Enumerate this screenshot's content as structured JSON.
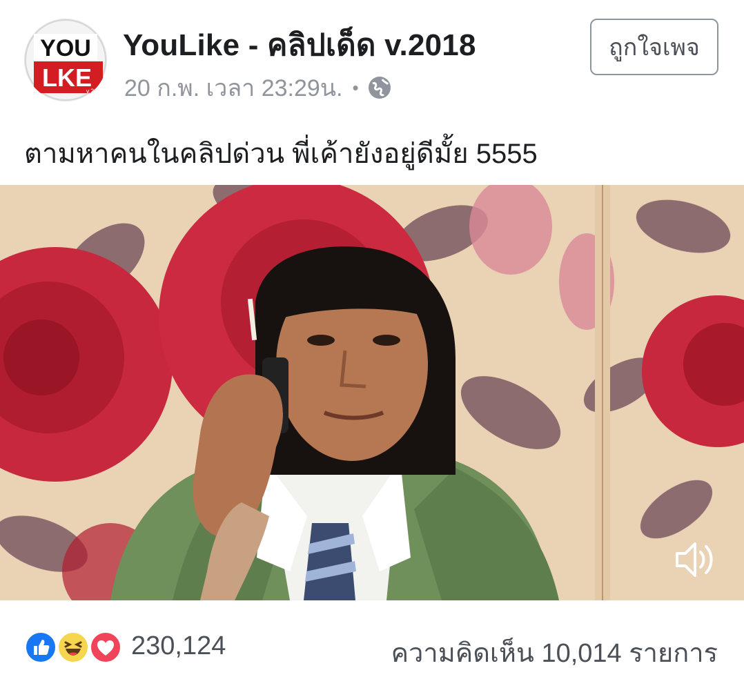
{
  "header": {
    "page_name": "YouLike - คลิปเด็ด v.2018",
    "timestamp": "20 ก.พ. เวลา 23:29น.",
    "separator": "•",
    "privacy_icon": "globe-icon",
    "like_page_label": "ถูกใจเพจ",
    "logo": {
      "top_text": "YOU",
      "bottom_text": "LKE",
      "version_text": "v.20",
      "accent_color": "#d41c23"
    }
  },
  "post": {
    "caption": "ตามหาคนในคลิปด่วน พี่เค้ายังอยู่ดีมั้ย 5555"
  },
  "video": {
    "sound_icon": "speaker-icon"
  },
  "footer": {
    "reaction_icons": [
      "like-icon",
      "haha-icon",
      "love-icon"
    ],
    "reaction_count": "230,124",
    "comments_label": "ความคิดเห็น 10,014 รายการ"
  },
  "colors": {
    "like_blue": "#1877f2",
    "haha_yellow": "#f7d64f",
    "love_red": "#f0445a",
    "meta_gray": "#90949c"
  }
}
